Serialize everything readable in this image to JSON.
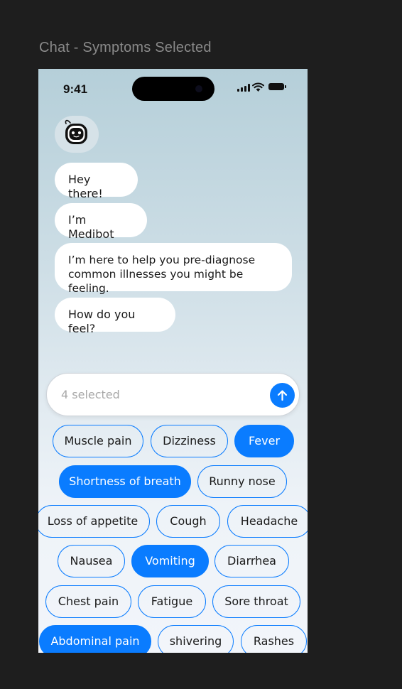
{
  "frame_label": "Chat - Symptoms Selected",
  "status_bar": {
    "time": "9:41"
  },
  "messages": [
    "Hey there!",
    "I’m Medibot",
    "I’m here to help you pre-diagnose\ncommon illnesses you might be feeling.",
    "How do you feel?"
  ],
  "input": {
    "placeholder": "4 selected"
  },
  "colors": {
    "accent": "#0a7cff",
    "bubble": "#ffffff"
  },
  "symptoms": [
    {
      "label": "Muscle pain",
      "selected": false
    },
    {
      "label": "Dizziness",
      "selected": false
    },
    {
      "label": "Fever",
      "selected": true
    },
    {
      "label": "Shortness of breath",
      "selected": true
    },
    {
      "label": "Runny nose",
      "selected": false
    },
    {
      "label": "Loss of appetite",
      "selected": false
    },
    {
      "label": "Cough",
      "selected": false
    },
    {
      "label": "Headache",
      "selected": false
    },
    {
      "label": "Nausea",
      "selected": false
    },
    {
      "label": "Vomiting",
      "selected": true
    },
    {
      "label": "Diarrhea",
      "selected": false
    },
    {
      "label": "Chest pain",
      "selected": false
    },
    {
      "label": "Fatigue",
      "selected": false
    },
    {
      "label": "Sore throat",
      "selected": false
    },
    {
      "label": "Abdominal pain",
      "selected": true
    },
    {
      "label": "shivering",
      "selected": false
    },
    {
      "label": "Rashes",
      "selected": false
    }
  ]
}
